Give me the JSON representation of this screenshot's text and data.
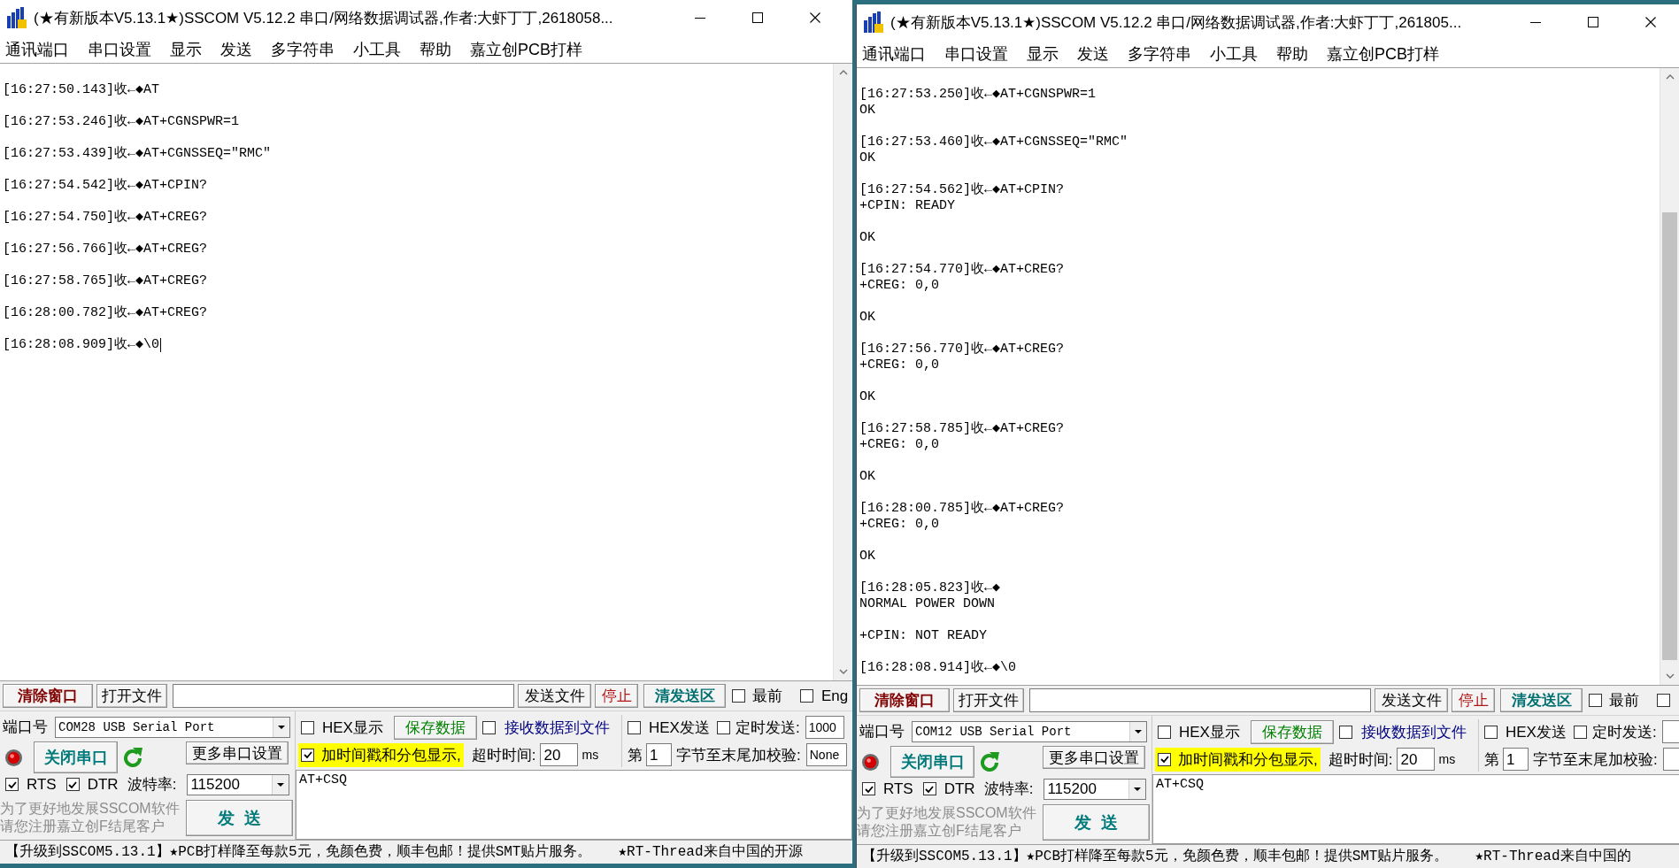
{
  "windows": [
    {
      "title": "(★有新版本V5.13.1★)SSCOM V5.12.2 串口/网络数据调试器,作者:大虾丁丁,2618058...",
      "menu": [
        "通讯端口",
        "串口设置",
        "显示",
        "发送",
        "多字符串",
        "小工具",
        "帮助",
        "嘉立创PCB打样"
      ],
      "log": [
        [
          "[16:27:50.143]收←◆AT"
        ],
        [
          "[16:27:53.246]收←◆AT+CGNSPWR=1"
        ],
        [
          "[16:27:53.439]收←◆AT+CGNSSEQ=\"RMC\""
        ],
        [
          "[16:27:54.542]收←◆AT+CPIN?"
        ],
        [
          "[16:27:54.750]收←◆AT+CREG?"
        ],
        [
          "[16:27:56.766]收←◆AT+CREG?"
        ],
        [
          "[16:27:58.765]收←◆AT+CREG?"
        ],
        [
          "[16:28:00.782]收←◆AT+CREG?"
        ],
        [
          "[16:28:08.909]收←◆\\0"
        ]
      ],
      "log_focused": true,
      "toolbar": {
        "left_buttons": [
          {
            "label": "清除窗口",
            "kind": "danger"
          },
          {
            "label": "打开文件",
            "kind": "plain"
          }
        ],
        "right_buttons": [
          {
            "label": "发送文件",
            "kind": "plain"
          },
          {
            "label": "停止",
            "kind": "stop"
          },
          {
            "label": "清发送区",
            "kind": "accent"
          }
        ],
        "options": [
          {
            "label": "最前",
            "checked": false
          },
          {
            "label": "Eng",
            "checked": false
          }
        ]
      },
      "port": {
        "label": "端口号",
        "value": "COM28 USB Serial Port",
        "open": true,
        "toggle_button": "关闭串口",
        "more_button": "更多串口设置"
      },
      "lines": [
        {
          "label": "RTS",
          "checked": true
        },
        {
          "label": "DTR",
          "checked": true
        }
      ],
      "baud": {
        "label": "波特率:",
        "value": "115200"
      },
      "promo": [
        "为了更好地发展SSCOM软件",
        "请您注册嘉立创F结尾客户"
      ],
      "send_button": "发  送",
      "receive": {
        "hex": {
          "label": "HEX显示",
          "checked": false
        },
        "save_button": "保存数据",
        "to_file": {
          "label": "接收数据到文件",
          "checked": false
        },
        "timestamp": {
          "label": "加时间戳和分包显示,",
          "checked": true
        },
        "timeout": {
          "label": "超时时间:",
          "value": "20",
          "unit": "ms"
        }
      },
      "send": {
        "hex": {
          "label": "HEX发送",
          "checked": false
        },
        "timed": {
          "label": "定时发送:",
          "checked": false,
          "value": "1000"
        },
        "start_byte": {
          "label": "第",
          "value": "1"
        },
        "checksum": {
          "label": "字节至末尾加校验:",
          "value": "None"
        }
      },
      "send_text": "AT+CSQ",
      "status": [
        "【升级到SSCOM5.13.1】★PCB打样降至每款5元，免颜色费，顺丰包邮！提供SMT贴片服务。",
        "★RT-Thread来自中国的开源"
      ]
    },
    {
      "title": "(★有新版本V5.13.1★)SSCOM V5.12.2 串口/网络数据调试器,作者:大虾丁丁,261805...",
      "menu": [
        "通讯端口",
        "串口设置",
        "显示",
        "发送",
        "多字符串",
        "小工具",
        "帮助",
        "嘉立创PCB打样"
      ],
      "log": [
        [
          "[16:27:53.250]收←◆AT+CGNSPWR=1",
          "OK"
        ],
        [
          "[16:27:53.460]收←◆AT+CGNSSEQ=\"RMC\"",
          "OK"
        ],
        [
          "[16:27:54.562]收←◆AT+CPIN?",
          "+CPIN: READY"
        ],
        [
          "OK"
        ],
        [
          "[16:27:54.770]收←◆AT+CREG?",
          "+CREG: 0,0"
        ],
        [
          "OK"
        ],
        [
          "[16:27:56.770]收←◆AT+CREG?",
          "+CREG: 0,0"
        ],
        [
          "OK"
        ],
        [
          "[16:27:58.785]收←◆AT+CREG?",
          "+CREG: 0,0"
        ],
        [
          "OK"
        ],
        [
          "[16:28:00.785]收←◆AT+CREG?",
          "+CREG: 0,0"
        ],
        [
          "OK"
        ],
        [
          "[16:28:05.823]收←◆",
          "NORMAL POWER DOWN"
        ],
        [
          "+CPIN: NOT READY"
        ],
        [
          "[16:28:08.914]收←◆\\0"
        ]
      ],
      "log_focused": false,
      "toolbar": {
        "left_buttons": [
          {
            "label": "清除窗口",
            "kind": "danger"
          },
          {
            "label": "打开文件",
            "kind": "plain"
          }
        ],
        "right_buttons": [
          {
            "label": "发送文件",
            "kind": "plain"
          },
          {
            "label": "停止",
            "kind": "stop"
          },
          {
            "label": "清发送区",
            "kind": "accent"
          }
        ],
        "options": [
          {
            "label": "最前",
            "checked": false
          },
          {
            "checked": false
          }
        ]
      },
      "port": {
        "label": "端口号",
        "value": "COM12 USB Serial Port",
        "open": true,
        "toggle_button": "关闭串口",
        "more_button": "更多串口设置"
      },
      "lines": [
        {
          "label": "RTS",
          "checked": true
        },
        {
          "label": "DTR",
          "checked": true
        }
      ],
      "baud": {
        "label": "波特率:",
        "value": "115200"
      },
      "promo": [
        "为了更好地发展SSCOM软件",
        "请您注册嘉立创F结尾客户"
      ],
      "send_button": "发  送",
      "receive": {
        "hex": {
          "label": "HEX显示",
          "checked": false
        },
        "save_button": "保存数据",
        "to_file": {
          "label": "接收数据到文件",
          "checked": false
        },
        "timestamp": {
          "label": "加时间戳和分包显示,",
          "checked": true
        },
        "timeout": {
          "label": "超时时间:",
          "value": "20",
          "unit": "ms"
        }
      },
      "send": {
        "hex": {
          "label": "HEX发送",
          "checked": false
        },
        "timed": {
          "label": "定时发送:",
          "checked": false
        },
        "start_byte": {
          "label": "第",
          "value": "1"
        },
        "checksum": {
          "label": "字节至末尾加校验:"
        }
      },
      "send_text": "AT+CSQ",
      "status": [
        "【升级到SSCOM5.13.1】★PCB打样降至每款5元，免颜色费，顺丰包邮！提供SMT贴片服务。",
        "★RT-Thread来自中国的"
      ]
    }
  ]
}
